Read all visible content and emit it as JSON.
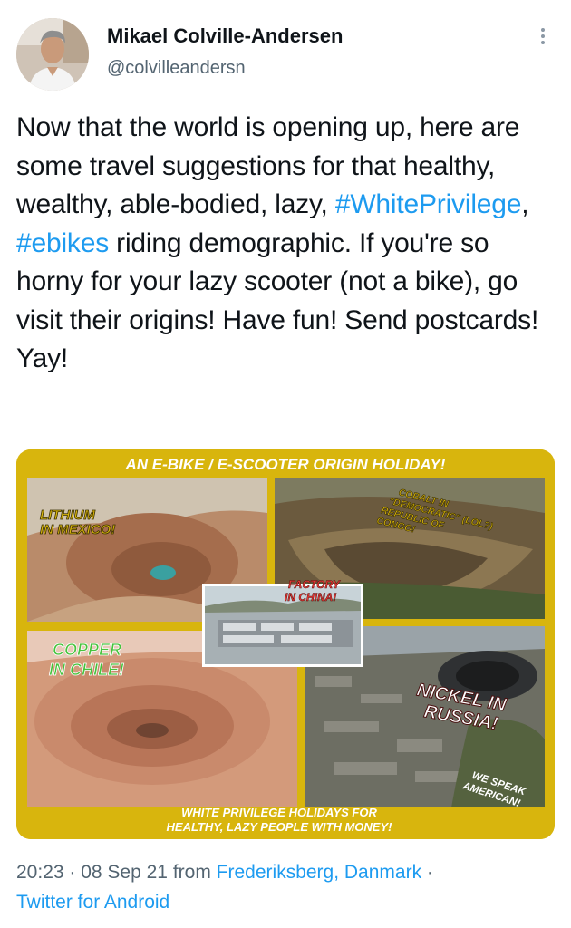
{
  "author": {
    "display_name": "Mikael Colville-Andersen",
    "handle": "@colvilleandersn"
  },
  "more_icon": "vertical-ellipsis-icon",
  "tweet": {
    "text_1": "Now that the world is opening up, here are some travel suggestions for that healthy, wealthy, able-bodied, lazy, ",
    "hashtag_1": "#WhitePrivilege",
    "text_2": ", ",
    "hashtag_2": "#ebikes",
    "text_3": " riding demographic. If you're so horny for your lazy scooter (not a bike), go visit their origins! Have fun! Send postcards! Yay!"
  },
  "media": {
    "header": "AN E-BIKE / E-SCOOTER ORIGIN HOLIDAY!",
    "lithium": [
      "LITHIUM",
      "IN MEXICO!"
    ],
    "cobalt": [
      "COBALT IN",
      "\"DEMOCRATIC\" (LOL?)",
      "REPUBLIC OF",
      "CONGO!"
    ],
    "factory": [
      "FACTORY",
      "IN CHINA!"
    ],
    "copper": [
      "COPPER",
      "IN CHILE!"
    ],
    "nickel": [
      "NICKEL IN",
      "RUSSIA!"
    ],
    "speak": [
      "WE SPEAK",
      "AMERICAN!"
    ],
    "footer": [
      "WHITE PRIVILEGE HOLIDAYS FOR",
      "HEALTHY, LAZY PEOPLE WITH MONEY!"
    ]
  },
  "meta": {
    "time": "20:23",
    "sep1": " · ",
    "date": "08 Sep 21",
    "from_label": " from ",
    "location": "Frederiksberg, Danmark",
    "sep2": " ·",
    "source": "Twitter for Android"
  },
  "colors": {
    "link": "#1d9bf0",
    "secondary_text": "#536471",
    "media_frame": "#d8b50d"
  }
}
